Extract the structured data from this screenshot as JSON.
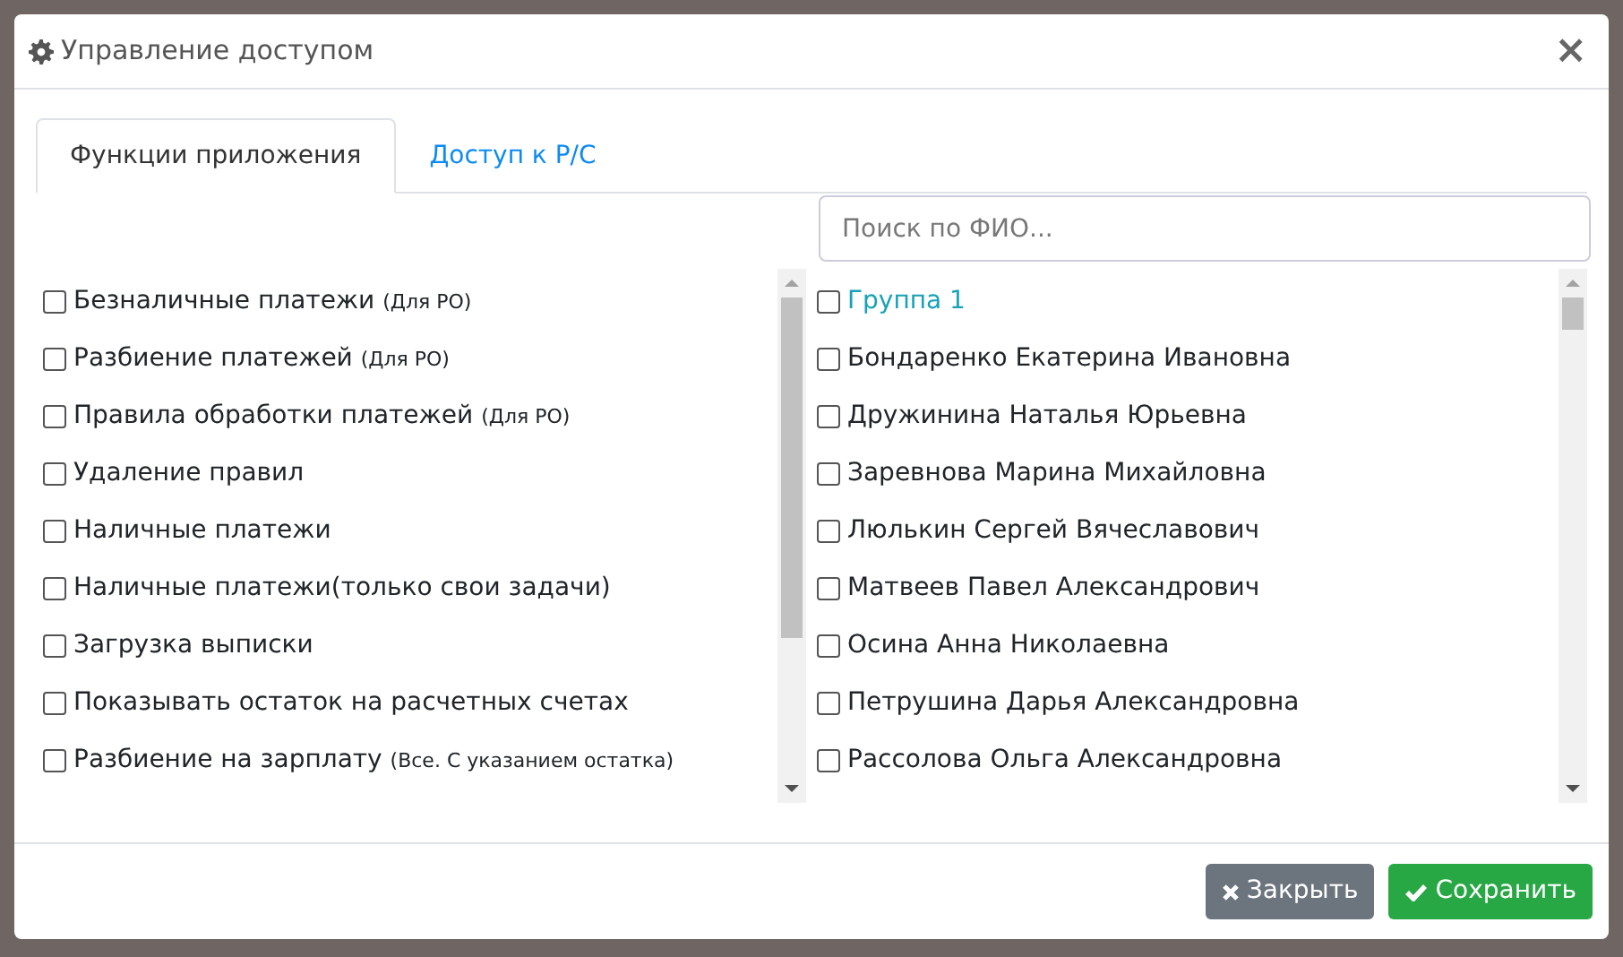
{
  "dialog": {
    "title": "Управление доступом",
    "close_label": "×"
  },
  "tabs": [
    {
      "label": "Функции приложения",
      "selected": true
    },
    {
      "label": "Доступ к Р/С",
      "selected": false
    }
  ],
  "functions": [
    {
      "label": "Безналичные платежи",
      "note": "(Для РО)",
      "checked": false
    },
    {
      "label": "Разбиение платежей",
      "note": "(Для РО)",
      "checked": false
    },
    {
      "label": "Правила обработки платежей",
      "note": "(Для РО)",
      "checked": false
    },
    {
      "label": "Удаление правил",
      "checked": false
    },
    {
      "label": "Наличные платежи",
      "checked": false
    },
    {
      "label": "Наличные платежи(только свои задачи)",
      "checked": false
    },
    {
      "label": "Загрузка выписки",
      "checked": false
    },
    {
      "label": "Показывать остаток на расчетных счетах",
      "checked": false
    },
    {
      "label": "Разбиение на зарплату",
      "note": "(Все. С указанием остатка)",
      "checked": false
    }
  ],
  "search": {
    "placeholder": "Поиск по ФИО..."
  },
  "people": [
    {
      "kind": "group",
      "label": "Группа 1",
      "checked": false
    },
    {
      "kind": "person",
      "label": "Бондаренко Екатерина Ивановна",
      "checked": false
    },
    {
      "kind": "person",
      "label": "Дружинина Наталья Юрьевна",
      "checked": false
    },
    {
      "kind": "person",
      "label": "Заревнова Марина Михайловна",
      "checked": false
    },
    {
      "kind": "person",
      "label": "Люлькин Сергей Вячеславович",
      "checked": false
    },
    {
      "kind": "person",
      "label": "Матвеев Павел Александрович",
      "checked": false
    },
    {
      "kind": "person",
      "label": "Осина Анна Николаевна",
      "checked": false
    },
    {
      "kind": "person",
      "label": "Петрушина Дарья Александровна",
      "checked": false
    },
    {
      "kind": "person",
      "label": "Рассолова Ольга Александровна",
      "checked": false
    }
  ],
  "buttons": [
    {
      "kind": "close",
      "label": "Закрыть"
    },
    {
      "kind": "save",
      "label": "Сохранить"
    }
  ]
}
